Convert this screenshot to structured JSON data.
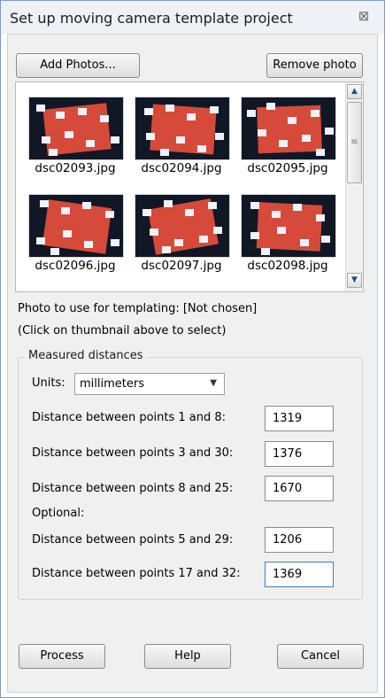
{
  "window": {
    "title": "Set up moving camera template project",
    "close_glyph": "⊠"
  },
  "toolbar": {
    "add_photos_label": "Add Photos...",
    "remove_photo_label": "Remove photo"
  },
  "thumbnails": [
    {
      "caption": "dsc02093.jpg"
    },
    {
      "caption": "dsc02094.jpg"
    },
    {
      "caption": "dsc02095.jpg"
    },
    {
      "caption": "dsc02096.jpg"
    },
    {
      "caption": "dsc02097.jpg"
    },
    {
      "caption": "dsc02098.jpg"
    }
  ],
  "scrollbar": {
    "up_icon": "arrow-up",
    "down_icon": "arrow-down"
  },
  "template_photo": {
    "label": "Photo to use for templating: [Not chosen]",
    "hint": "(Click on thumbnail above to select)"
  },
  "measured": {
    "legend": "Measured distances",
    "units_label": "Units:",
    "units_value": "millimeters",
    "optional_label": "Optional:",
    "rows": [
      {
        "label": "Distance between points 1 and 8:",
        "value": "1319"
      },
      {
        "label": "Distance between points 3 and 30:",
        "value": "1376"
      },
      {
        "label": "Distance between points 8 and 25:",
        "value": "1670"
      },
      {
        "label": "Distance between points 5 and 29:",
        "value": "1206"
      },
      {
        "label": "Distance between points 17 and 32:",
        "value": "1369"
      }
    ]
  },
  "footer": {
    "process_label": "Process",
    "help_label": "Help",
    "cancel_label": "Cancel"
  },
  "colors": {
    "window_border": "#7a9cc4",
    "dialog_bg": "#f0f0f0",
    "scroll_arrow": "#2a4f86"
  }
}
